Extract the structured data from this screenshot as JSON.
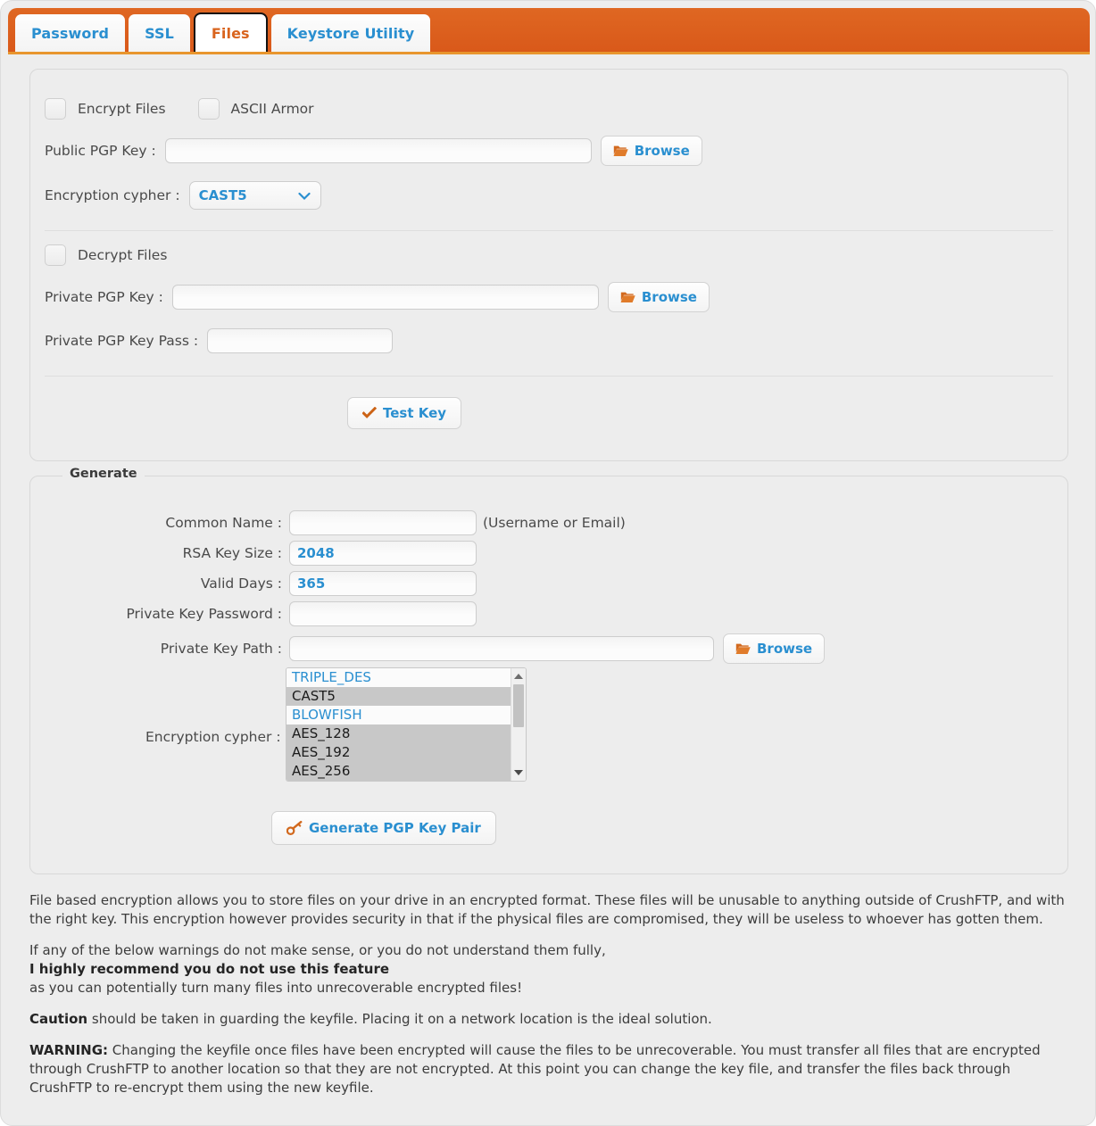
{
  "tabs": [
    {
      "label": "Password",
      "active": false
    },
    {
      "label": "SSL",
      "active": false
    },
    {
      "label": "Files",
      "active": true
    },
    {
      "label": "Keystore Utility",
      "active": false
    }
  ],
  "encrypt_section": {
    "encrypt_files_label": "Encrypt Files",
    "ascii_armor_label": "ASCII Armor",
    "public_key_label": "Public PGP Key :",
    "public_key_value": "",
    "public_key_placeholder": "",
    "browse_label": "Browse",
    "cypher_label": "Encryption cypher :",
    "cypher_value": "CAST5",
    "cypher_options": [
      "TRIPLE_DES",
      "CAST5",
      "BLOWFISH",
      "AES_128",
      "AES_192",
      "AES_256"
    ]
  },
  "decrypt_section": {
    "decrypt_files_label": "Decrypt Files",
    "private_key_label": "Private PGP Key :",
    "private_key_value": "",
    "browse_label": "Browse",
    "private_key_pass_label": "Private PGP Key Pass :",
    "private_key_pass_value": "",
    "test_key_label": "Test Key"
  },
  "generate": {
    "legend": "Generate",
    "common_name_label": "Common Name :",
    "common_name_value": "",
    "common_name_hint": "(Username or Email)",
    "rsa_key_size_label": "RSA Key Size :",
    "rsa_key_size_value": "2048",
    "valid_days_label": "Valid Days :",
    "valid_days_value": "365",
    "private_key_password_label": "Private Key Password :",
    "private_key_password_value": "",
    "private_key_path_label": "Private Key Path :",
    "private_key_path_value": "",
    "browse_label": "Browse",
    "cypher_label": "Encryption cypher :",
    "cypher_list": [
      {
        "label": "TRIPLE_DES",
        "selected": false
      },
      {
        "label": "CAST5",
        "selected": true
      },
      {
        "label": "BLOWFISH",
        "selected": false
      },
      {
        "label": "AES_128",
        "selected": true
      },
      {
        "label": "AES_192",
        "selected": true
      },
      {
        "label": "AES_256",
        "selected": true
      }
    ],
    "generate_button_label": "Generate PGP Key Pair"
  },
  "info": {
    "p1": "File based encryption allows you to store files on your drive in an encrypted format. These files will be unusable to anything outside of CrushFTP, and with the right key. This encryption however provides security in that if the physical files are compromised, they will be useless to whoever has gotten them.",
    "p2_line1": "If any of the below warnings do not make sense, or you do not understand them fully,",
    "p2_bold": "I highly recommend you do not use this feature",
    "p2_line3": "as you can potentially turn many files into unrecoverable encrypted files!",
    "p3_bold": "Caution",
    "p3_rest": " should be taken in guarding the keyfile. Placing it on a network location is the ideal solution.",
    "p4_bold": "WARNING:",
    "p4_rest": " Changing the keyfile once files have been encrypted will cause the files to be unrecoverable. You must transfer all files that are encrypted through CrushFTP to another location so that they are not encrypted. At this point you can change the key file, and transfer the files back through CrushFTP to re-encrypt them using the new keyfile."
  },
  "colors": {
    "accent_orange": "#d9591a",
    "link_blue": "#2a8fd0",
    "panel_bg": "#ededed",
    "selected_row": "#c8c8c8"
  }
}
